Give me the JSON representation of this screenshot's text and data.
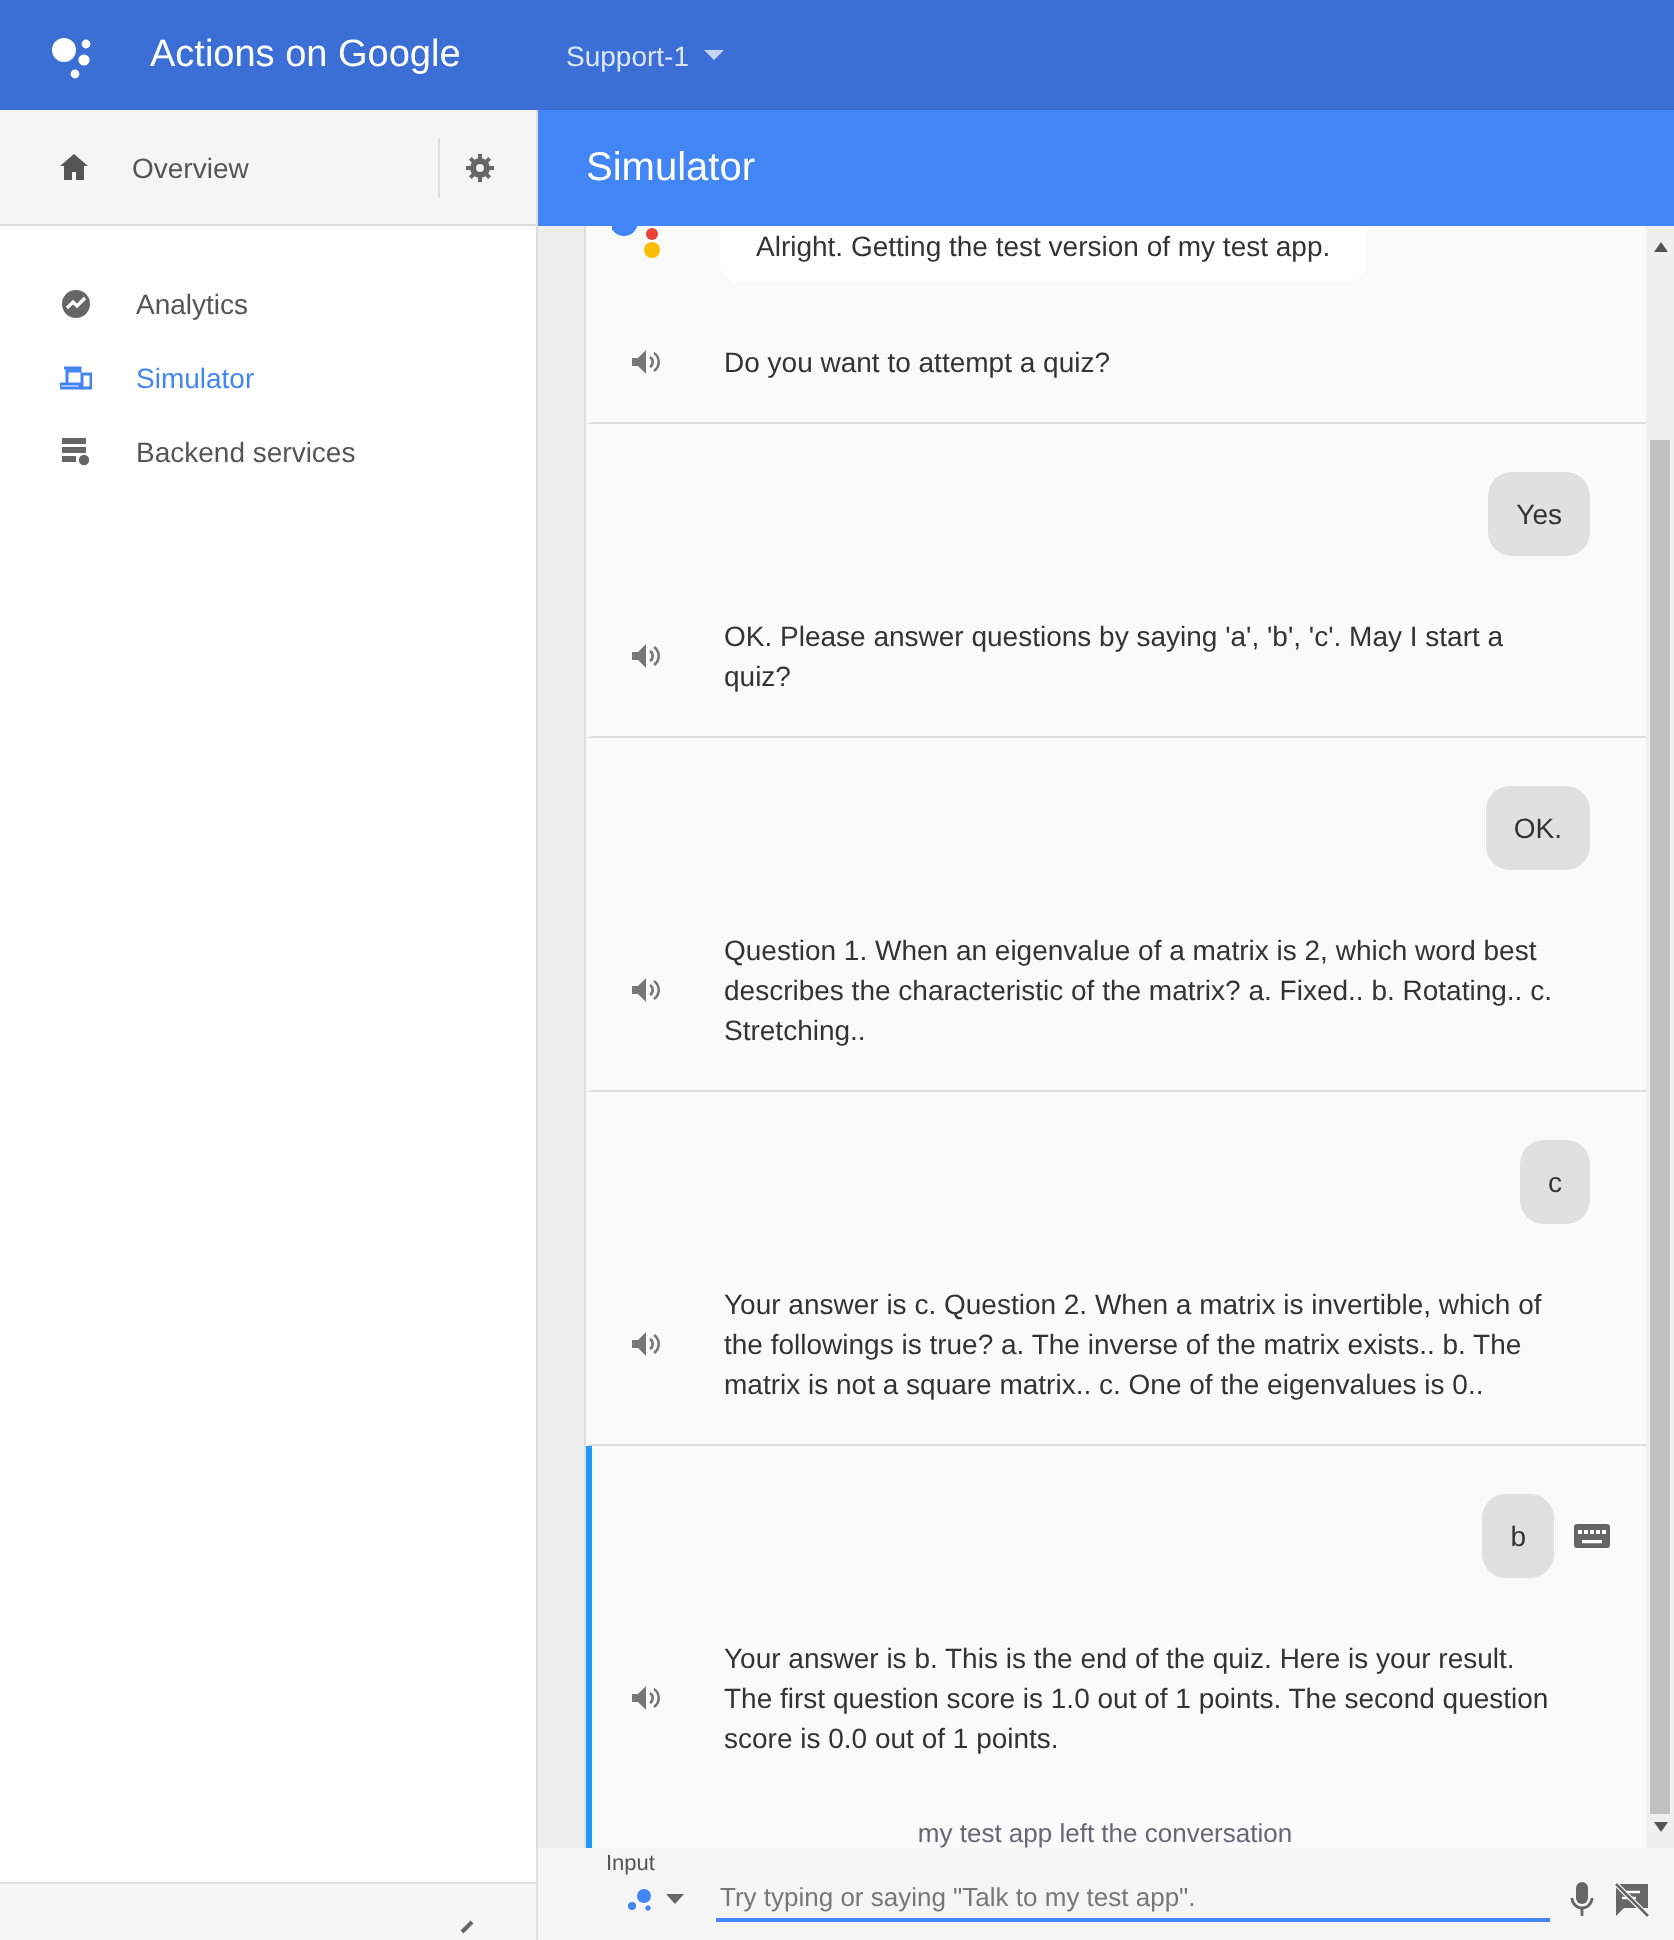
{
  "app": {
    "title": "Actions on Google",
    "project": "Support-1"
  },
  "sidebar": {
    "overview": "Overview",
    "items": [
      {
        "label": "Analytics",
        "kind": "analytics",
        "selected": false
      },
      {
        "label": "Simulator",
        "kind": "devices",
        "selected": true
      },
      {
        "label": "Backend services",
        "kind": "server",
        "selected": false
      }
    ]
  },
  "simulator": {
    "title": "Simulator",
    "turns": [
      {
        "intro": "Alright. Getting the test version of my test app.",
        "replies": [
          "Do you want to attempt a quiz?"
        ],
        "selected": false
      },
      {
        "user": "Yes",
        "typed": false,
        "replies": [
          "OK. Please answer questions by saying 'a', 'b', 'c'. May I start a quiz?"
        ],
        "selected": false
      },
      {
        "user": "OK.",
        "typed": false,
        "replies": [
          "Question 1. When an eigenvalue of a matrix is 2, which word best describes the characteristic of the matrix? a. Fixed.. b. Rotating.. c. Stretching.."
        ],
        "selected": false
      },
      {
        "user": "c",
        "typed": false,
        "replies": [
          "Your answer is c. Question 2. When a matrix is invertible, which of the followings is true? a. The inverse of the matrix exists.. b. The matrix is not a square matrix.. c. One of the eigenvalues is 0.."
        ],
        "selected": false
      },
      {
        "user": "b",
        "typed": true,
        "replies": [
          "Your answer is b. This is the end of the quiz. Here is your result. The first question score is 1.0 out of 1 points. The second question score is 0.0 out of 1 points."
        ],
        "footer": "my test app left the conversation",
        "selected": true
      }
    ],
    "input": {
      "label": "Input",
      "placeholder": "Try typing or saying \"Talk to my test app\"."
    }
  }
}
